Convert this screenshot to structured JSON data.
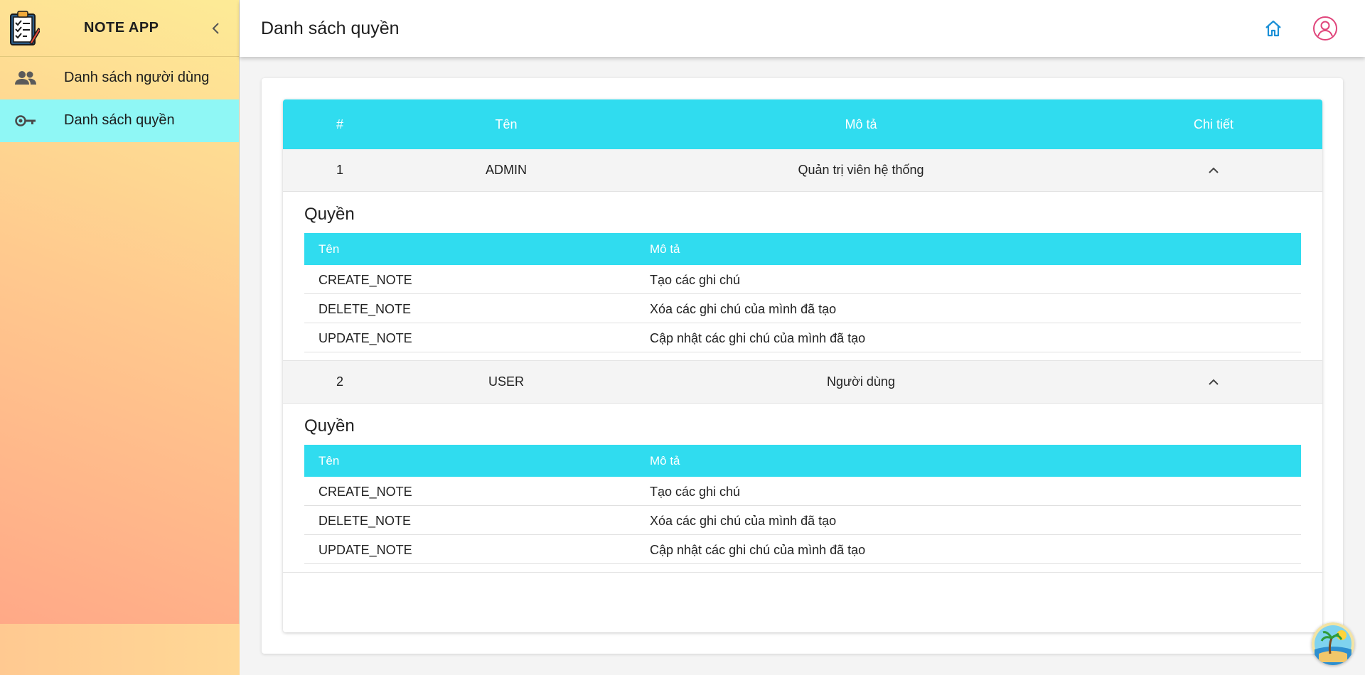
{
  "app": {
    "title": "NOTE APP"
  },
  "sidebar": {
    "items": [
      {
        "label": "Danh sách người dùng",
        "icon": "users-icon"
      },
      {
        "label": "Danh sách quyền",
        "icon": "key-icon"
      }
    ]
  },
  "header": {
    "title": "Danh sách quyền"
  },
  "table": {
    "columns": [
      "#",
      "Tên",
      "Mô tả",
      "Chi tiết"
    ],
    "rows": [
      {
        "num": "1",
        "name": "ADMIN",
        "description": "Quản trị viên hệ thống",
        "detail_title": "Quyền",
        "sub_columns": [
          "Tên",
          "Mô tả"
        ],
        "permissions": [
          {
            "name": "CREATE_NOTE",
            "description": "Tạo các ghi chú"
          },
          {
            "name": "DELETE_NOTE",
            "description": "Xóa các ghi chú của mình đã tạo"
          },
          {
            "name": "UPDATE_NOTE",
            "description": "Cập nhật các ghi chú của mình đã tạo"
          }
        ]
      },
      {
        "num": "2",
        "name": "USER",
        "description": "Người dùng",
        "detail_title": "Quyền",
        "sub_columns": [
          "Tên",
          "Mô tả"
        ],
        "permissions": [
          {
            "name": "CREATE_NOTE",
            "description": "Tạo các ghi chú"
          },
          {
            "name": "DELETE_NOTE",
            "description": "Xóa các ghi chú của mình đã tạo"
          },
          {
            "name": "UPDATE_NOTE",
            "description": "Cập nhật các ghi chú của mình đã tạo"
          }
        ]
      }
    ]
  },
  "colors": {
    "accent": "#30dcef",
    "active_nav": "#8ff7f5",
    "home_icon": "#1a8fd6",
    "user_icon": "#e0457b"
  }
}
